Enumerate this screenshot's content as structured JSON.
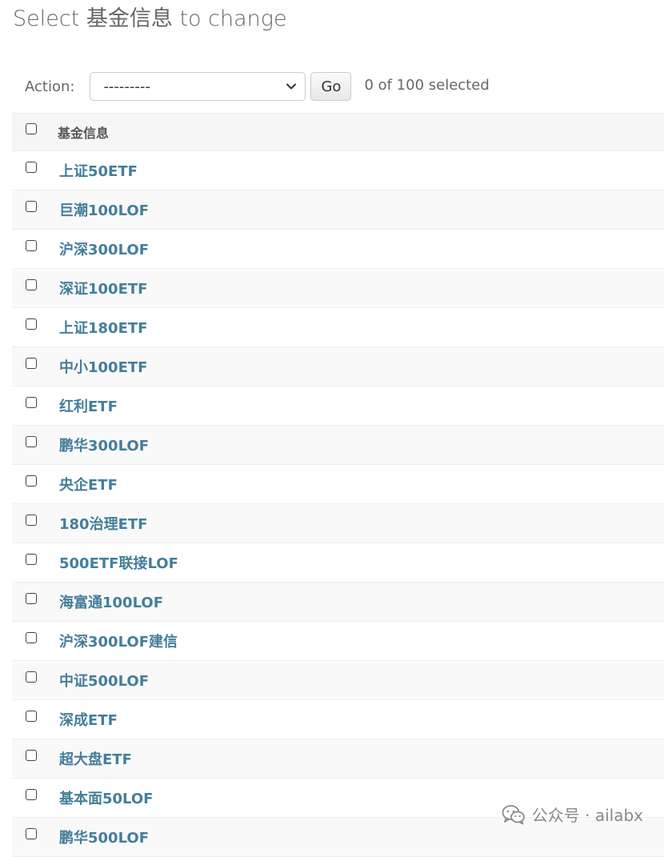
{
  "page": {
    "title": "Select 基金信息 to change"
  },
  "actions": {
    "label": "Action:",
    "select_value": "---------",
    "go_label": "Go",
    "counter": "0 of 100 selected"
  },
  "table": {
    "column_header": "基金信息",
    "rows": [
      "上证50ETF",
      "巨潮100LOF",
      "沪深300LOF",
      "深证100ETF",
      "上证180ETF",
      "中小100ETF",
      "红利ETF",
      "鹏华300LOF",
      "央企ETF",
      "180治理ETF",
      "500ETF联接LOF",
      "海富通100LOF",
      "沪深300LOF建信",
      "中证500LOF",
      "深成ETF",
      "超大盘ETF",
      "基本面50LOF",
      "鹏华500LOF"
    ]
  },
  "watermark": {
    "text": "公众号 · ailabx",
    "icon": "wechat-icon"
  },
  "colors": {
    "link": "#447e9b",
    "header_bg": "#f6f6f6",
    "row_alt_bg": "#f9f9f9"
  }
}
